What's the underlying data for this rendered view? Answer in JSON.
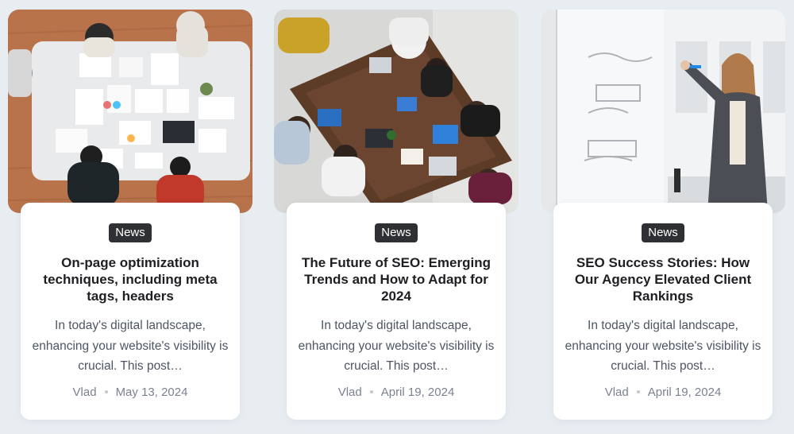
{
  "posts": [
    {
      "badge": "News",
      "title": "On-page optimization techniques, including meta tags, headers",
      "excerpt": "In today's digital landscape, enhancing your website's visibility is crucial. This post…",
      "author": "Vlad",
      "date": "May 13, 2024",
      "image_icon": "office-team-table-photo"
    },
    {
      "badge": "News",
      "title": "The Future of SEO: Emerging Trends and How to Adapt for 2024",
      "excerpt": "In today's digital landscape, enhancing your website's visibility is crucial. This post…",
      "author": "Vlad",
      "date": "April 19, 2024",
      "image_icon": "teamwork-laptops-photo"
    },
    {
      "badge": "News",
      "title": "SEO Success Stories: How Our Agency Elevated Client Rankings",
      "excerpt": "In today's digital landscape, enhancing your website's visibility is crucial. This post…",
      "author": "Vlad",
      "date": "April 19, 2024",
      "image_icon": "presenter-whiteboard-photo"
    }
  ],
  "colors": {
    "page_background": "#e8edf2",
    "badge_background": "#2f3033",
    "title_text": "#1e1f23",
    "excerpt_text": "#4d5563",
    "meta_text": "#7b8290"
  }
}
